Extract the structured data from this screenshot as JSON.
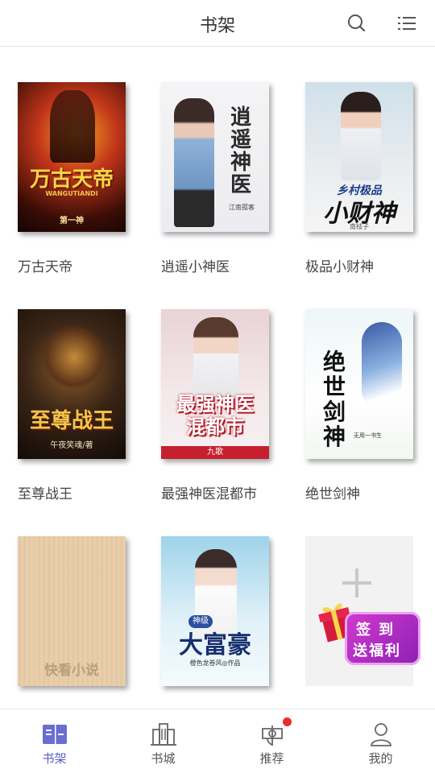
{
  "header": {
    "title": "书架",
    "search_icon": "search-icon",
    "menu_icon": "list-menu-icon"
  },
  "books": [
    {
      "title": "万古天帝",
      "cover_title": "万古天帝",
      "cover_sub": "WANGUTIANDI",
      "cover_author": "第一神"
    },
    {
      "title": "逍遥小神医",
      "cover_title": "逍遥神医",
      "cover_author": "江南孤客"
    },
    {
      "title": "极品小财神",
      "cover_title_top": "乡村极品",
      "cover_title": "小财神",
      "cover_author": "南枝子"
    },
    {
      "title": "至尊战王",
      "cover_title": "至尊战王",
      "cover_author": "午夜笑魂/著"
    },
    {
      "title": "最强神医混都市",
      "cover_title_top": "最强神医",
      "cover_title": "混都市",
      "cover_author": "九歌"
    },
    {
      "title": "绝世剑神",
      "cover_title": "绝世剑神",
      "cover_author": "无用一书生"
    },
    {
      "title": "",
      "cover_title": "快看小说"
    },
    {
      "title": "",
      "cover_tag": "神级",
      "cover_title": "大富豪",
      "cover_author": "橙色龙卷风◎作品"
    }
  ],
  "promo": {
    "line1": "签到",
    "line2": "送福利",
    "gift_icon": "gift-box-icon"
  },
  "tabs": [
    {
      "label": "书架",
      "icon": "bookshelf-icon",
      "active": true
    },
    {
      "label": "书城",
      "icon": "bookstore-building-icon",
      "active": false
    },
    {
      "label": "推荐",
      "icon": "recommend-icon",
      "active": false,
      "badge": true
    },
    {
      "label": "我的",
      "icon": "profile-icon",
      "active": false
    }
  ],
  "colors": {
    "accent": "#5b5fc7",
    "badge": "#ee2b2b",
    "promo": "#b62ad0"
  }
}
